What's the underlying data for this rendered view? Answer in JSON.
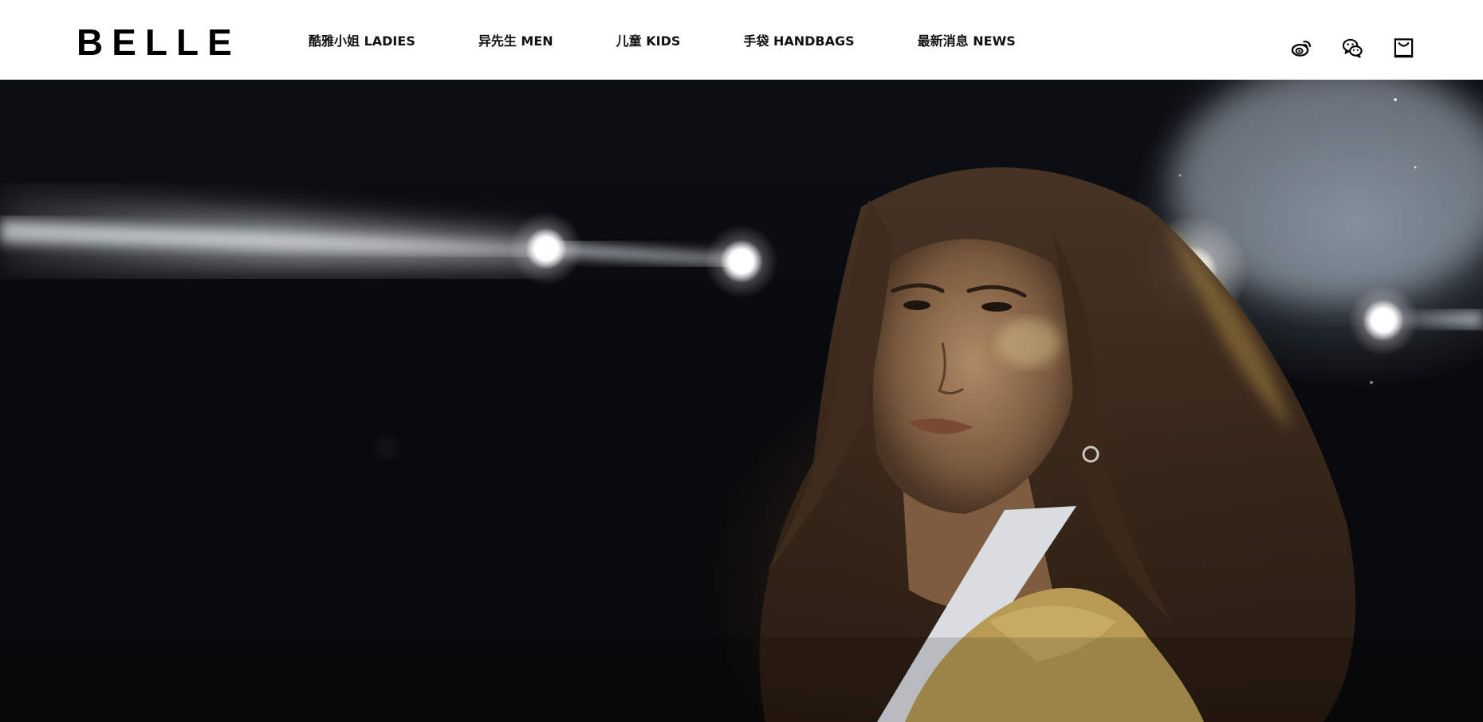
{
  "header": {
    "logo": "BELLE",
    "nav": [
      {
        "label": "酷雅小姐 LADIES"
      },
      {
        "label": "异先生 MEN"
      },
      {
        "label": "儿童 KIDS"
      },
      {
        "label": "手袋 HANDBAGS"
      },
      {
        "label": "最新消息 NEWS"
      }
    ],
    "icons": [
      "weibo-icon",
      "wechat-icon",
      "shopping-bag-icon"
    ]
  },
  "hero": {
    "image": "fashion-model-under-stage-spotlights"
  },
  "colors": {
    "header_bg": "#ffffff",
    "text": "#111111",
    "hero_bg": "#07090c"
  }
}
